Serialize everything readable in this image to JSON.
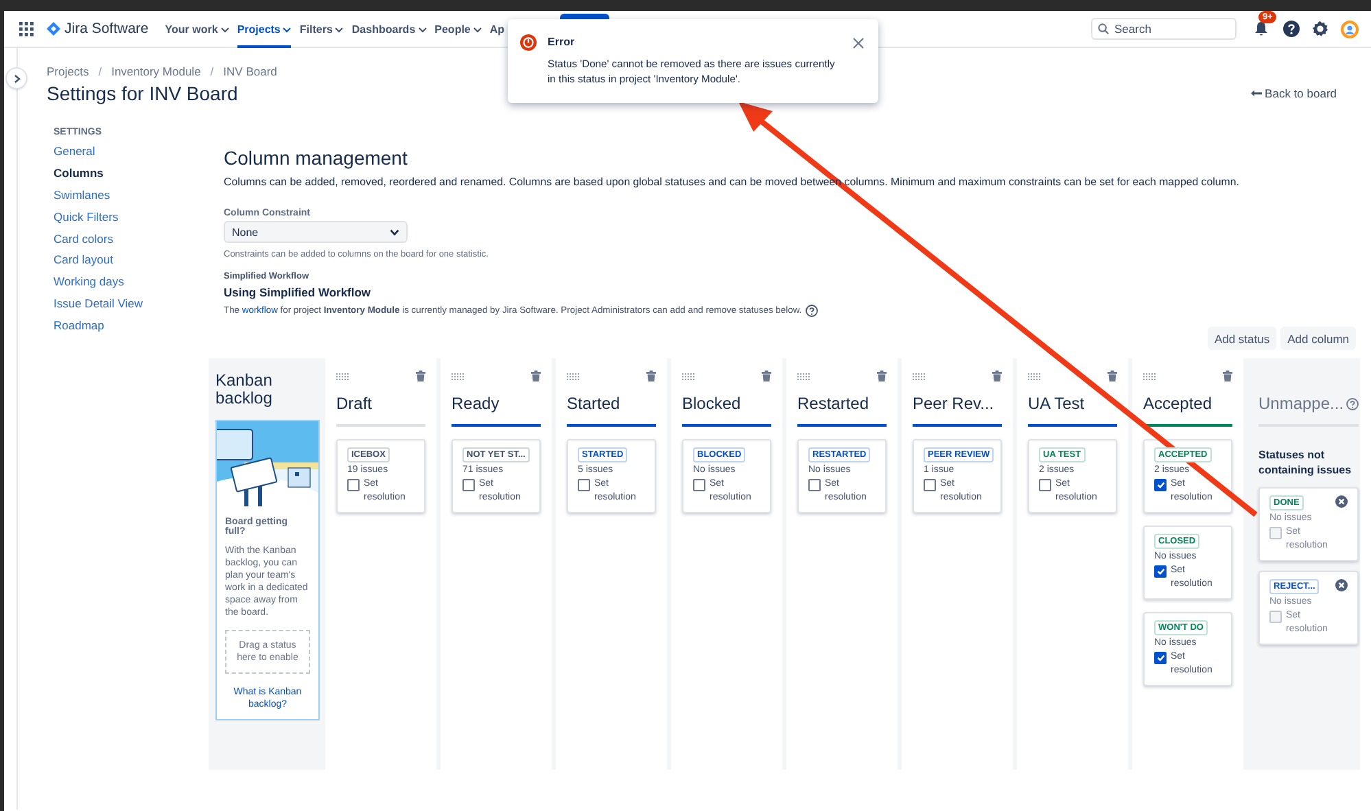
{
  "nav": {
    "product": "Jira Software",
    "items": [
      {
        "label": "Your work",
        "selected": false
      },
      {
        "label": "Projects",
        "selected": true
      },
      {
        "label": "Filters",
        "selected": false
      },
      {
        "label": "Dashboards",
        "selected": false
      },
      {
        "label": "People",
        "selected": false
      },
      {
        "label": "Ap",
        "selected": false
      }
    ],
    "search": {
      "placeholder": "Search"
    },
    "notifications": "9+"
  },
  "toast": {
    "title": "Error",
    "message": "Status 'Done' cannot be removed as there are issues currently in this status in project 'Inventory Module'."
  },
  "breadcrumbs": [
    {
      "kind": "link",
      "text": "Projects"
    },
    {
      "kind": "separator",
      "text": "/"
    },
    {
      "kind": "link",
      "text": "Inventory Module"
    },
    {
      "kind": "separator",
      "text": "/"
    },
    {
      "kind": "link",
      "text": "INV Board"
    }
  ],
  "title": "Settings for INV Board",
  "back_link": "Back to board",
  "sidebar": {
    "heading": "SETTINGS",
    "items": [
      {
        "label": "General",
        "selected": false
      },
      {
        "label": "Columns",
        "selected": true
      },
      {
        "label": "Swimlanes",
        "selected": false
      },
      {
        "label": "Quick Filters",
        "selected": false
      },
      {
        "label": "Card colors",
        "selected": false
      },
      {
        "label": "Card layout",
        "selected": false
      },
      {
        "label": "Working days",
        "selected": false
      },
      {
        "label": "Issue Detail View",
        "selected": false
      },
      {
        "label": "Roadmap",
        "selected": false
      }
    ]
  },
  "main": {
    "heading": "Column management",
    "description": "Columns can be added, removed, reordered and renamed. Columns are based upon global statuses and can be moved between columns. Minimum and maximum constraints can be set for each mapped column.",
    "constraint": {
      "label": "Column Constraint",
      "value": "None",
      "help": "Constraints can be added to columns on the board for one statistic."
    },
    "workflow": {
      "label": "Simplified Workflow",
      "heading": "Using Simplified Workflow",
      "note_before": "The",
      "link": "workflow",
      "note_after": "for project **Inventory Module** is currently managed by Jira Software. Project Administrators can add and remove statuses below."
    },
    "buttons": [
      "Add status",
      "Add column"
    ]
  },
  "backlog": {
    "title": "Kanban backlog",
    "heading": "Board getting full?",
    "text": "With the Kanban backlog, you can plan your team's work in a dedicated space away from the board.",
    "drop": "Drag a status here to enable",
    "link": "What is Kanban backlog?"
  },
  "columns": [
    {
      "title": "Draft",
      "color": "#dfe1e6",
      "statuses": [
        {
          "label": "ICEBOX",
          "color": "#42526e",
          "count": "19 issues",
          "resolution": "Set resolution",
          "checked": false
        }
      ]
    },
    {
      "title": "Ready",
      "color": "#0052cc",
      "statuses": [
        {
          "label": "NOT YET ST...",
          "color": "#42526e",
          "count": "71 issues",
          "resolution": "Set resolution",
          "checked": false
        }
      ]
    },
    {
      "title": "Started",
      "color": "#0052cc",
      "statuses": [
        {
          "label": "STARTED",
          "color": "#0052cc",
          "count": "5 issues",
          "resolution": "Set resolution",
          "checked": false
        }
      ]
    },
    {
      "title": "Blocked",
      "color": "#0052cc",
      "statuses": [
        {
          "label": "BLOCKED",
          "color": "#0052cc",
          "count": "No issues",
          "resolution": "Set resolution",
          "checked": false
        }
      ]
    },
    {
      "title": "Restarted",
      "color": "#0052cc",
      "statuses": [
        {
          "label": "RESTARTED",
          "color": "#0052cc",
          "count": "No issues",
          "resolution": "Set resolution",
          "checked": false
        }
      ]
    },
    {
      "title": "Peer Rev...",
      "color": "#0052cc",
      "statuses": [
        {
          "label": "PEER REVIEW",
          "color": "#0052cc",
          "count": "1 issue",
          "resolution": "Set resolution",
          "checked": false
        }
      ]
    },
    {
      "title": "UA Test",
      "color": "#0052cc",
      "statuses": [
        {
          "label": "UA TEST",
          "color": "#00875a",
          "count": "2 issues",
          "resolution": "Set resolution",
          "checked": false
        }
      ]
    },
    {
      "title": "Accepted",
      "color": "#00875a",
      "statuses": [
        {
          "label": "ACCEPTED",
          "color": "#00875a",
          "count": "2 issues",
          "resolution": "Set resolution",
          "checked": true
        },
        {
          "label": "CLOSED",
          "color": "#00875a",
          "count": "No issues",
          "resolution": "Set resolution",
          "checked": true
        },
        {
          "label": "WON'T DO",
          "color": "#00875a",
          "count": "No issues",
          "resolution": "Set resolution",
          "checked": true
        }
      ]
    }
  ],
  "unmapped": {
    "title": "Unmappe...",
    "subtitle": "Statuses not containing issues",
    "statuses": [
      {
        "label": "DONE",
        "color": "#00875a",
        "count": "No issues",
        "resolution": "Set resolution",
        "checked": false,
        "disabled": true
      },
      {
        "label": "REJECT...",
        "color": "#0052cc",
        "count": "No issues",
        "resolution": "Set resolution",
        "checked": false,
        "disabled": true
      }
    ]
  },
  "annotations": [
    {
      "kind": "arrow"
    }
  ]
}
